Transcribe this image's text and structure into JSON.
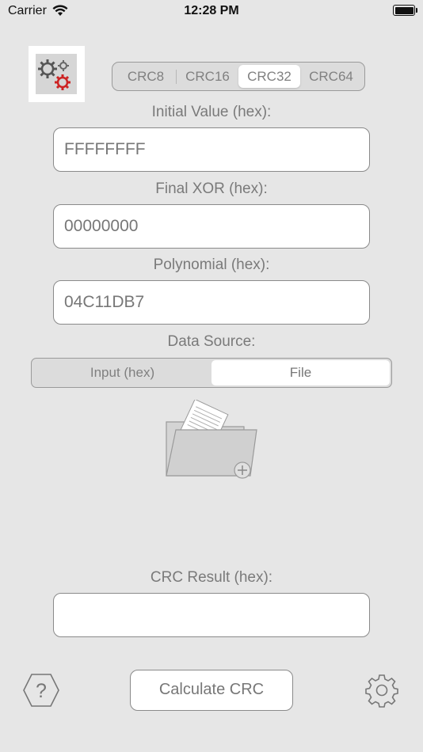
{
  "status_bar": {
    "carrier": "Carrier",
    "time": "12:28 PM"
  },
  "crc_types": {
    "items": [
      "CRC8",
      "CRC16",
      "CRC32",
      "CRC64"
    ],
    "selected": "CRC32"
  },
  "initial_value": {
    "label": "Initial Value (hex):",
    "value": "FFFFFFFF"
  },
  "final_xor": {
    "label": "Final XOR (hex):",
    "value": "00000000"
  },
  "polynomial": {
    "label": "Polynomial (hex):",
    "value": "04C11DB7"
  },
  "data_source": {
    "label": "Data Source:",
    "options": [
      "Input (hex)",
      "File"
    ],
    "selected": "File"
  },
  "result": {
    "label": "CRC Result (hex):",
    "value": ""
  },
  "buttons": {
    "calculate": "Calculate CRC"
  },
  "icons": {
    "app": "gears-icon",
    "folder": "folder-add-icon",
    "help": "help-icon",
    "settings": "gear-icon"
  },
  "colors": {
    "background": "#e6e6e6",
    "accent_red": "#cc2222",
    "text": "#7a7a7a"
  }
}
